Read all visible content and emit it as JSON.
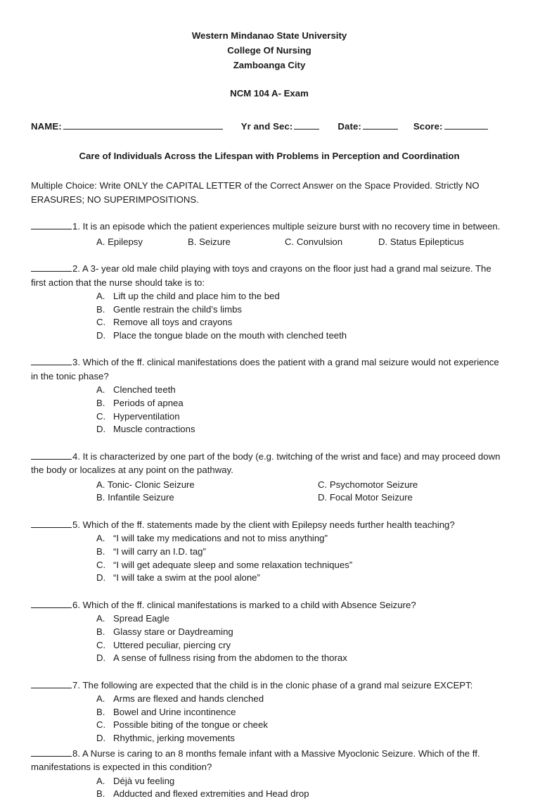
{
  "header": {
    "line1": "Western Mindanao State University",
    "line2": "College Of Nursing",
    "line3": "Zamboanga City",
    "exam_title": "NCM 104 A- Exam"
  },
  "name_row": {
    "name_label": "NAME:",
    "yr_and_sec_label": "Yr and Sec:",
    "date_label": "Date:",
    "score_label": "Score:"
  },
  "subtitle": "Care of Individuals Across the Lifespan with Problems in Perception and Coordination",
  "instructions": "Multiple Choice: Write ONLY the CAPITAL LETTER of the Correct Answer on the Space Provided. Strictly NO ERASURES; NO SUPERIMPOSITIONS.",
  "questions": [
    {
      "number": "1.",
      "text": "It is an episode which the patient experiences multiple seizure burst with no recovery time in between.",
      "layout": "inline",
      "choices": [
        "A. Epilepsy",
        "B. Seizure",
        "C. Convulsion",
        "D. Status Epilepticus"
      ]
    },
    {
      "number": "2.",
      "text": "A 3- year old male child playing with toys and crayons on the floor just had a grand mal seizure. The first action that the nurse should take is to:",
      "layout": "list",
      "choices": [
        {
          "letter": "A.",
          "text": "Lift up the child and place him to the bed"
        },
        {
          "letter": "B.",
          "text": "Gentle restrain the child’s limbs"
        },
        {
          "letter": "C.",
          "text": "Remove all toys and crayons"
        },
        {
          "letter": "D.",
          "text": "Place the tongue blade on the mouth with clenched teeth"
        }
      ]
    },
    {
      "number": "3.",
      "text": "Which of the ff. clinical manifestations does the patient with a grand mal seizure would not experience in the tonic phase?",
      "layout": "list",
      "choices": [
        {
          "letter": "A.",
          "text": " Clenched teeth"
        },
        {
          "letter": "B.",
          "text": "Periods of apnea"
        },
        {
          "letter": "C.",
          "text": "Hyperventilation"
        },
        {
          "letter": "D.",
          "text": "Muscle contractions"
        }
      ]
    },
    {
      "number": "4.",
      "text": "It is characterized by one part of the body (e.g. twitching of the wrist and face) and may proceed down the body or localizes at any point on the pathway.",
      "layout": "two-column",
      "choices": [
        {
          "col_a": "A. Tonic- Clonic Seizure",
          "col_b": "C. Psychomotor Seizure"
        },
        {
          "col_a": "B. Infantile Seizure",
          "col_b": "D. Focal Motor Seizure"
        }
      ]
    },
    {
      "number": "5.",
      "text": "Which of the ff. statements made by the client with Epilepsy needs further health teaching?",
      "layout": "list",
      "choices": [
        {
          "letter": "A.",
          "text": "“I will take my medications and not to miss anything”"
        },
        {
          "letter": "B.",
          "text": "“I will carry an I.D. tag”"
        },
        {
          "letter": "C.",
          "text": "“I will get adequate sleep and some relaxation techniques”"
        },
        {
          "letter": "D.",
          "text": "“I will take a swim at the pool alone”"
        }
      ]
    },
    {
      "number": "6.",
      "text": "Which of the ff. clinical manifestations is marked to a child with Absence Seizure?",
      "layout": "list",
      "choices": [
        {
          "letter": "A.",
          "text": "Spread Eagle"
        },
        {
          "letter": "B.",
          "text": "Glassy stare or Daydreaming"
        },
        {
          "letter": "C.",
          "text": "Uttered peculiar, piercing cry"
        },
        {
          "letter": "D.",
          "text": "A sense of fullness rising from the abdomen to the thorax"
        }
      ]
    },
    {
      "number": "7.",
      "text": "The following are expected that the child is in the clonic phase of a grand mal seizure EXCEPT:",
      "layout": "list",
      "choices": [
        {
          "letter": "A.",
          "text": "Arms are flexed and hands clenched"
        },
        {
          "letter": "B.",
          "text": "Bowel and Urine incontinence"
        },
        {
          "letter": "C.",
          "text": "Possible biting of the tongue or cheek"
        },
        {
          "letter": "D.",
          "text": "Rhythmic, jerking movements"
        }
      ]
    },
    {
      "number": "8.",
      "text": "A Nurse is caring to an 8 months female infant with a Massive Myoclonic Seizure. Which of the ff. manifestations is expected in this condition?",
      "layout": "list",
      "choices": [
        {
          "letter": "A.",
          "text": "Déjà vu feeling"
        },
        {
          "letter": "B.",
          "text": "Adducted and flexed extremities and Head drop"
        }
      ]
    }
  ]
}
